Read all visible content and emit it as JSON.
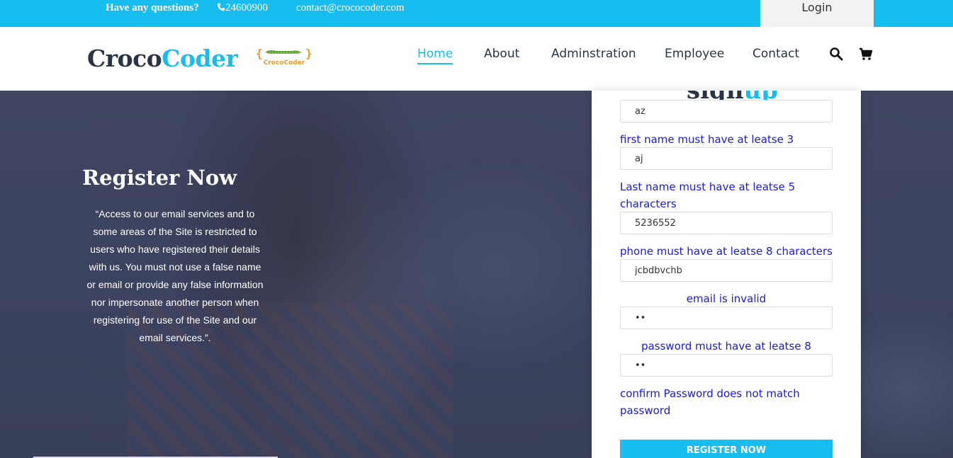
{
  "topbar": {
    "question": "Have any questions?",
    "phone": "24600900",
    "email": "contact@crococoder.com",
    "login": "Login"
  },
  "header": {
    "brand_part1": "Croco",
    "brand_part2": "Coder",
    "logo_text": "CrocoCoder",
    "nav": [
      "Home",
      "About",
      "Adminstration",
      "Employee",
      "Contact"
    ],
    "active_nav": "Home",
    "icons": [
      "search-icon",
      "cart-icon"
    ]
  },
  "hero": {
    "title": "Register Now",
    "text": "“Access to our email services and to some areas of the Site is restricted to users who have registered their details with us. You must not use a false name or email or provide any false information nor impersonate another person when registering for use of the Site and our email services.”."
  },
  "form": {
    "title_part1": "sign",
    "title_part2": "up",
    "first_name_value": "az",
    "first_name_error": "first name must have at leatse 3 characters",
    "last_name_value": "aj",
    "last_name_error": "Last name must have at leatse 5 characters",
    "phone_value": "5236552",
    "phone_error": "phone must have at leatse 8 characters",
    "email_value": "jcbdbvchb",
    "email_error": "email is invalid",
    "password_value": "••",
    "password_error": "password must have at leatse 8 characters",
    "confirm_value": "••",
    "confirm_error": "confirm Password does not match password",
    "submit_label": "REGISTER NOW"
  },
  "colors": {
    "accent": "#16bdee",
    "dark": "#2b3445",
    "error": "#1a1adb"
  }
}
